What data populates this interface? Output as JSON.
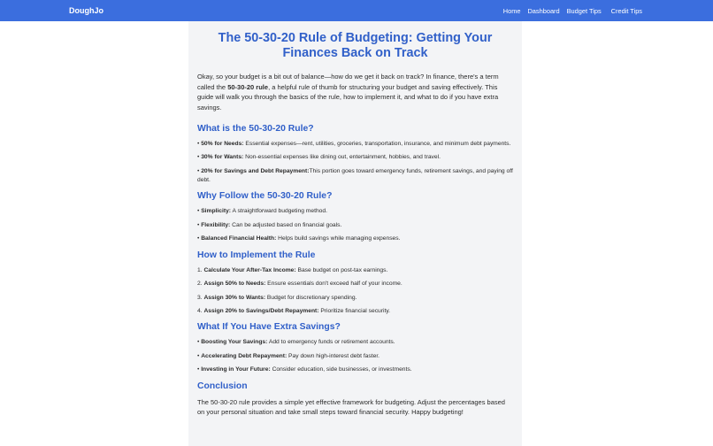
{
  "nav": {
    "brand": "DoughJo",
    "links": [
      "Home",
      "Dashboard",
      "Budget Tips",
      "Credit Tips"
    ]
  },
  "article": {
    "title": "The 50-30-20 Rule of Budgeting: Getting Your Finances Back on Track",
    "intro_part1": "Okay, so your budget is a bit out of balance—how do we get it back on track? In finance, there's a term called the ",
    "intro_bold": "50-30-20 rule",
    "intro_part2": ", a helpful rule of thumb for structuring your budget and saving effectively. This guide will walk you through the basics of the rule, how to implement it, and what to do if you have extra savings.",
    "sections": [
      {
        "heading": "What is the 50-30-20 Rule?",
        "items": [
          {
            "bullet": "•",
            "bold": "50% for Needs:",
            "text": " Essential expenses—rent, utilities, groceries, transportation, insurance, and minimum debt payments."
          },
          {
            "bullet": "•",
            "bold": "30% for Wants:",
            "text": " Non-essential expenses like dining out, entertainment, hobbies, and travel."
          },
          {
            "bullet": "•",
            "bold": "20% for Savings and Debt Repayment:",
            "text": "This portion goes toward emergency funds, retirement savings, and paying off debt."
          }
        ]
      },
      {
        "heading": "Why Follow the 50-30-20 Rule?",
        "items": [
          {
            "bullet": "•",
            "bold": "Simplicity:",
            "text": " A straightforward budgeting method."
          },
          {
            "bullet": "•",
            "bold": "Flexibility:",
            "text": " Can be adjusted based on financial goals."
          },
          {
            "bullet": "•",
            "bold": "Balanced Financial Health:",
            "text": " Helps build savings while managing expenses."
          }
        ]
      },
      {
        "heading": "How to Implement the Rule",
        "items": [
          {
            "bullet": "1.",
            "bold": "Calculate Your After-Tax Income:",
            "text": " Base budget on post-tax earnings."
          },
          {
            "bullet": "2.",
            "bold": "Assign 50% to Needs:",
            "text": " Ensure essentials don't exceed half of your income."
          },
          {
            "bullet": "3.",
            "bold": "Assign 30% to Wants:",
            "text": " Budget for discretionary spending."
          },
          {
            "bullet": "4.",
            "bold": "Assign 20% to Savings/Debt Repayment:",
            "text": " Prioritize financial security."
          }
        ]
      },
      {
        "heading": "What If You Have Extra Savings?",
        "items": [
          {
            "bullet": "•",
            "bold": "Boosting Your Savings:",
            "text": " Add to emergency funds or retirement accounts."
          },
          {
            "bullet": "•",
            "bold": "Accelerating Debt Repayment:",
            "text": " Pay down high-interest debt faster."
          },
          {
            "bullet": "•",
            "bold": "Investing in Your Future:",
            "text": " Consider education, side businesses, or investments."
          }
        ]
      }
    ],
    "conclusion_heading": "Conclusion",
    "conclusion_text": "The 50-30-20 rule provides a simple yet effective framework for budgeting. Adjust the percentages based on your personal situation and take small steps toward financial security. Happy budgeting!"
  }
}
